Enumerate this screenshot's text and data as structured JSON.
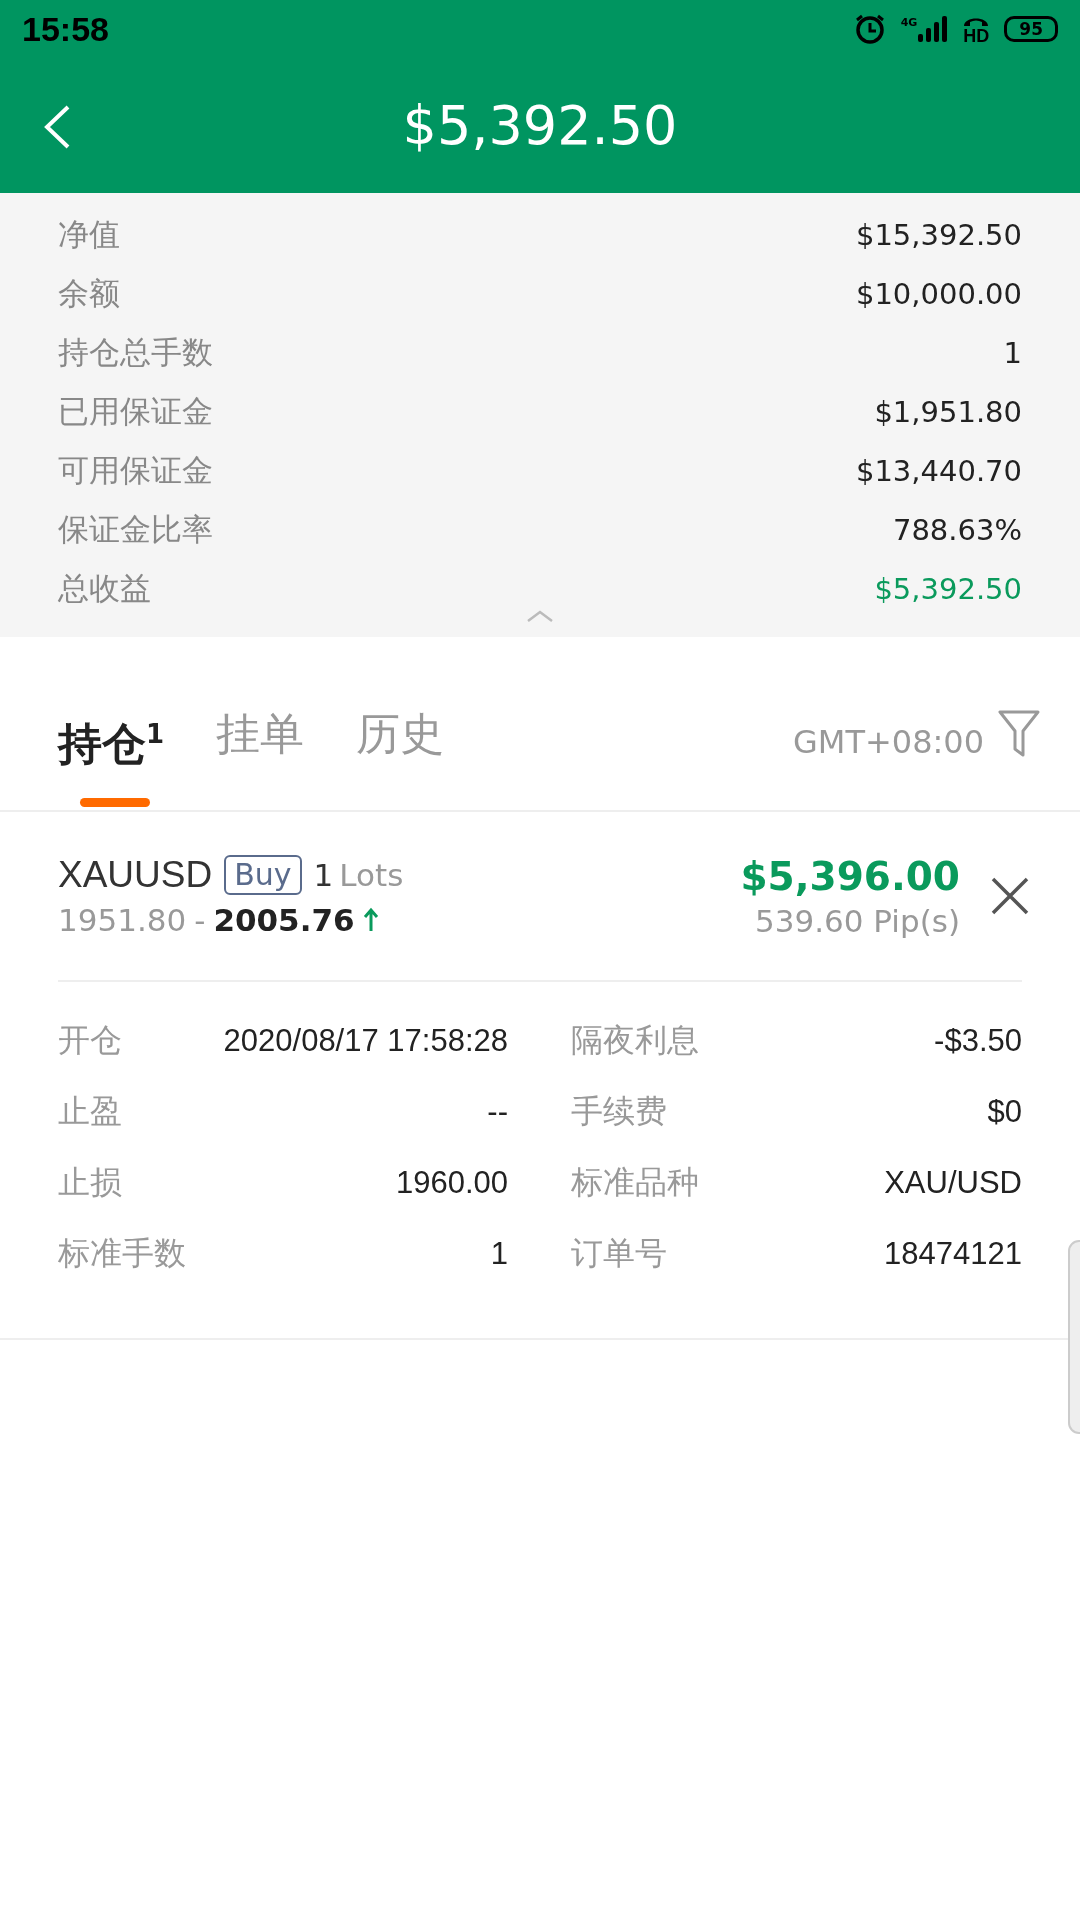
{
  "status_bar": {
    "time": "15:58",
    "network": "4G",
    "battery": "95",
    "hd": "HD"
  },
  "header": {
    "title": "$5,392.50"
  },
  "summary": [
    {
      "label": "净值",
      "value": "$15,392.50",
      "highlight": false
    },
    {
      "label": "余额",
      "value": "$10,000.00",
      "highlight": false
    },
    {
      "label": "持仓总手数",
      "value": "1",
      "highlight": false
    },
    {
      "label": "已用保证金",
      "value": "$1,951.80",
      "highlight": false
    },
    {
      "label": "可用保证金",
      "value": "$13,440.70",
      "highlight": false
    },
    {
      "label": "保证金比率",
      "value": "788.63%",
      "highlight": false
    },
    {
      "label": "总收益",
      "value": "$5,392.50",
      "highlight": true
    }
  ],
  "tabs": [
    {
      "label": "持仓",
      "count": "1",
      "selected": true
    },
    {
      "label": "挂单",
      "selected": false
    },
    {
      "label": "历史",
      "selected": false
    }
  ],
  "timezone": "GMT+08:00",
  "position": {
    "symbol": "XAUUSD",
    "side": "Buy",
    "lots": "1",
    "lots_unit": "Lots",
    "open_price": "1951.80",
    "separator": "-",
    "current_price": "2005.76",
    "up": true,
    "profit": "$5,396.00",
    "pips": "539.60 Pip(s)"
  },
  "details": [
    {
      "left": {
        "label": "开仓",
        "value": "2020/08/17 17:58:28"
      },
      "right": {
        "label": "隔夜利息",
        "value": "-$3.50"
      }
    },
    {
      "left": {
        "label": "止盈",
        "value": "--"
      },
      "right": {
        "label": "手续费",
        "value": "$0"
      }
    },
    {
      "left": {
        "label": "止损",
        "value": "1960.00"
      },
      "right": {
        "label": "标准品种",
        "value": "XAU/USD"
      }
    },
    {
      "left": {
        "label": "标准手数",
        "value": "1"
      },
      "right": {
        "label": "订单号",
        "value": "18474121"
      }
    }
  ]
}
